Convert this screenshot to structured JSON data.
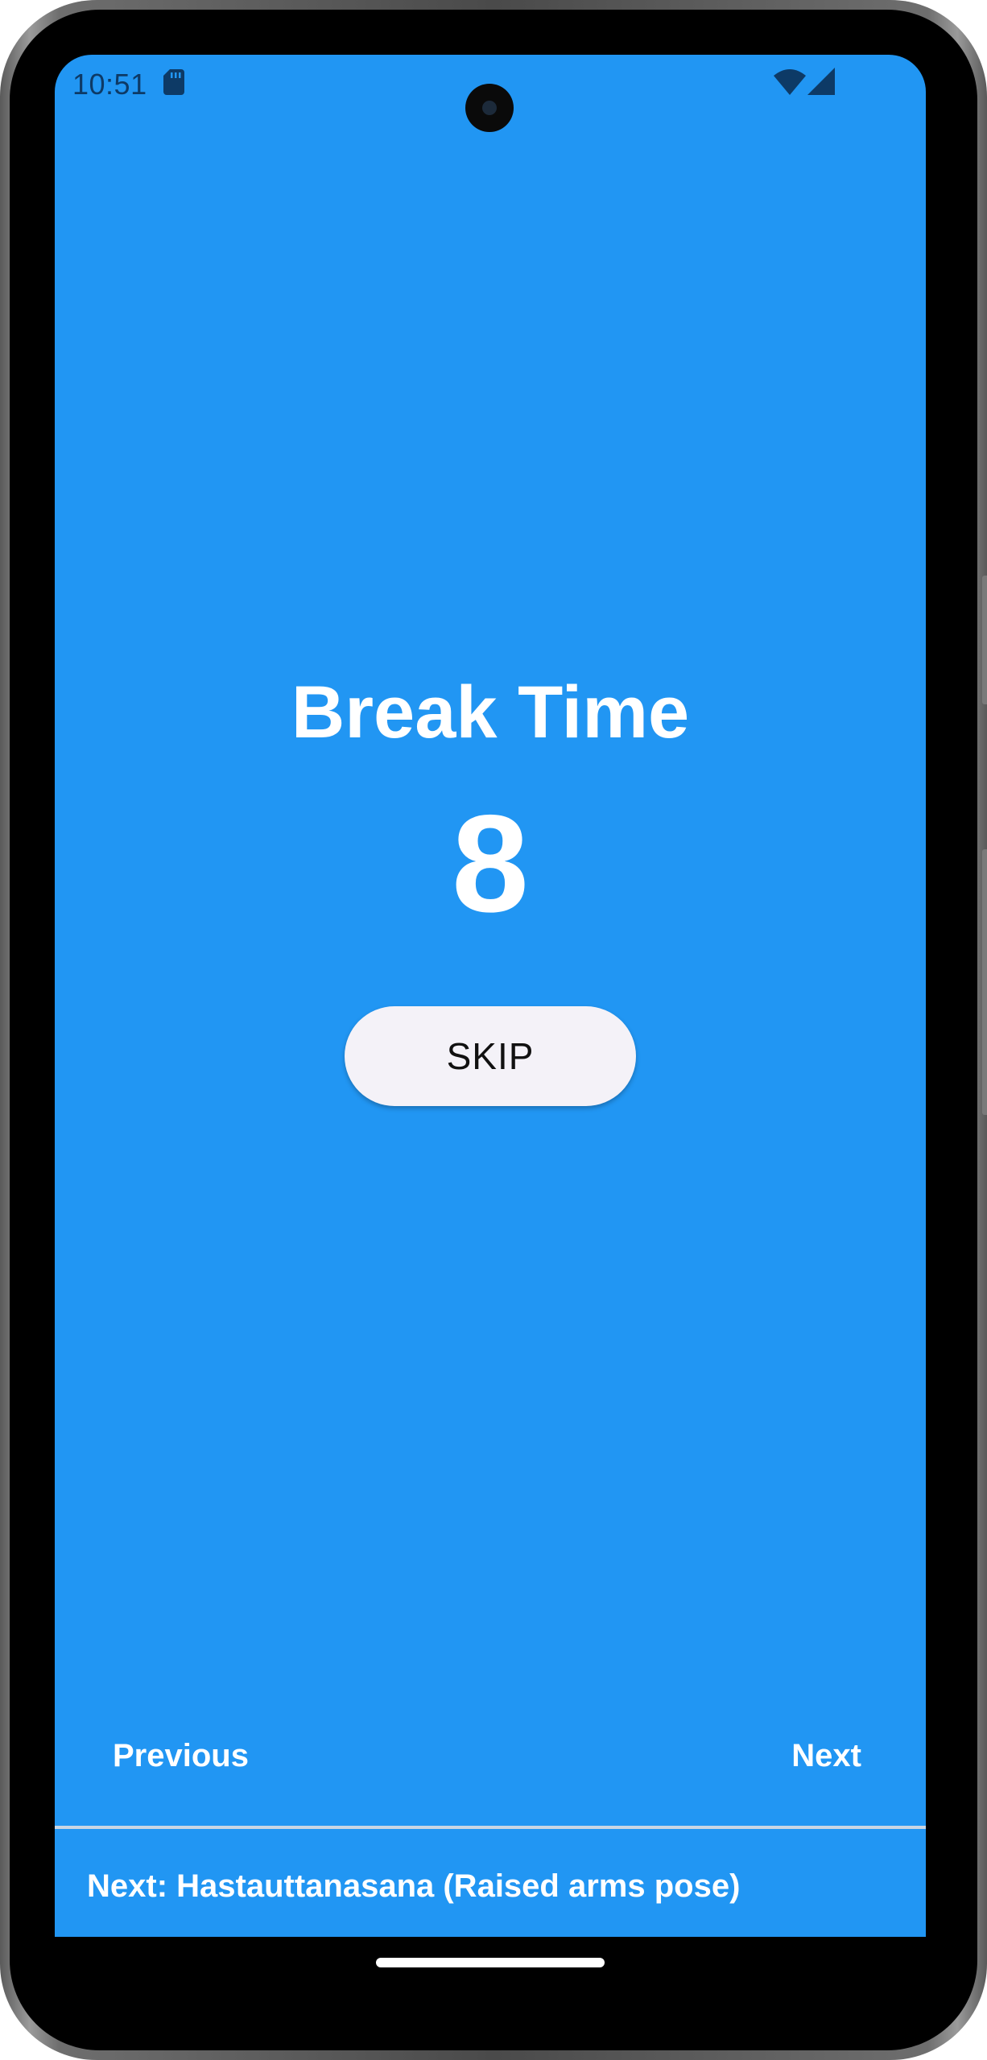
{
  "status_bar": {
    "time": "10:51",
    "icons": [
      "sd-card-icon",
      "wifi-icon",
      "cellular-signal-icon"
    ]
  },
  "screen": {
    "background_color": "#2196F3",
    "title": "Break Time",
    "countdown": "8",
    "skip_label": "SKIP"
  },
  "navigation": {
    "previous_label": "Previous",
    "next_label": "Next"
  },
  "footer": {
    "next_exercise": "Next: Hastauttanasana (Raised arms pose)"
  }
}
